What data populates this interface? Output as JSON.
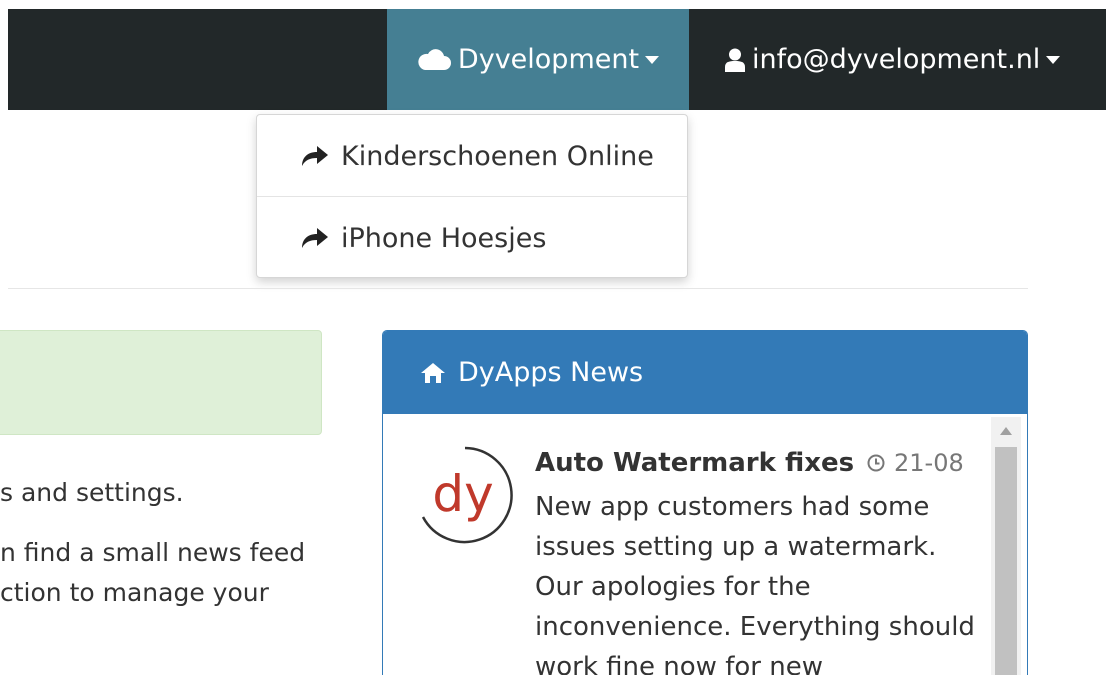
{
  "navbar": {
    "brand_label": "Dyvelopment",
    "brand_icon": "cloud-icon",
    "user_label": "info@dyvelopment.nl",
    "user_icon": "user-icon",
    "brand_color": "#457f93",
    "bar_color": "#222829"
  },
  "dropdown": {
    "items": [
      {
        "label": "Kinderschoenen Online",
        "icon": "share-icon"
      },
      {
        "label": "iPhone Hoesjes",
        "icon": "share-icon"
      }
    ]
  },
  "intro": {
    "line1": "s and settings.",
    "line2": "n find a small news feed",
    "line3": "ction to manage your"
  },
  "news": {
    "heading": "DyApps News",
    "heading_icon": "home-icon",
    "panel_color": "#337ab7",
    "items": [
      {
        "logo_text": "dy",
        "title": "Auto Watermark fixes",
        "date": "21-08",
        "body": "New app customers had some issues setting up a watermark. Our apologies for the inconvenience. Everything should work fine now for new"
      }
    ]
  }
}
